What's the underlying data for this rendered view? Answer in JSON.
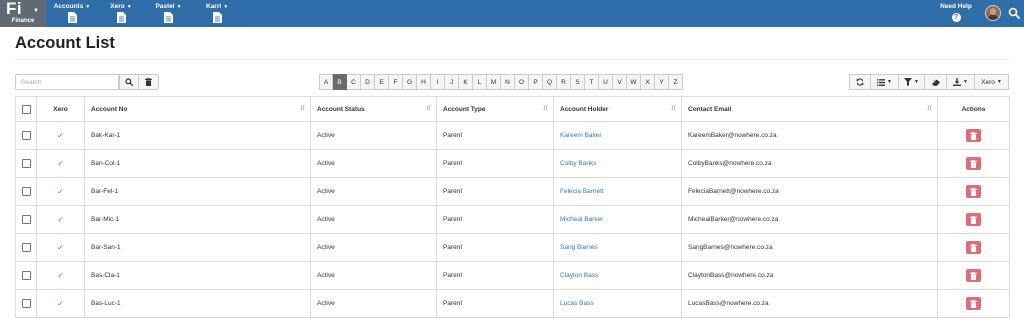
{
  "nav": {
    "brand_big": "Fi",
    "brand_small": "Finance",
    "items": [
      {
        "label": "Accounts"
      },
      {
        "label": "Xero"
      },
      {
        "label": "Pastel"
      },
      {
        "label": "Karri"
      }
    ],
    "help_label": "Need Help",
    "help_icon": "?"
  },
  "page": {
    "title": "Account List"
  },
  "search": {
    "placeholder": "Search",
    "value": ""
  },
  "alphabet": {
    "letters": [
      "A",
      "B",
      "C",
      "D",
      "E",
      "F",
      "G",
      "H",
      "I",
      "J",
      "K",
      "L",
      "M",
      "N",
      "O",
      "P",
      "Q",
      "R",
      "S",
      "T",
      "U",
      "V",
      "W",
      "X",
      "Y",
      "Z"
    ],
    "active": "B"
  },
  "toolbar": {
    "xero_label": "Xero"
  },
  "table": {
    "headers": {
      "xero": "Xero",
      "account_no": "Account No",
      "account_status": "Account Status",
      "account_type": "Account Type",
      "account_holder": "Account Holder",
      "contact_email": "Contact Email",
      "actions": "Actions"
    },
    "rows": [
      {
        "account_no": "Bak-Kar-1",
        "status": "Active",
        "type": "Parent",
        "holder": "Kareem Baker",
        "email": "KareemBaker@nowhere.co.za"
      },
      {
        "account_no": "Ban-Col-1",
        "status": "Active",
        "type": "Parent",
        "holder": "Colby Banks",
        "email": "ColbyBanks@nowhere.co.za"
      },
      {
        "account_no": "Bar-Fel-1",
        "status": "Active",
        "type": "Parent",
        "holder": "Felecia Barnett",
        "email": "FeleciaBarnett@nowhere.co.za"
      },
      {
        "account_no": "Bar-Mic-1",
        "status": "Active",
        "type": "Parent",
        "holder": "Micheal Barker",
        "email": "MichealBarker@nowhere.co.za"
      },
      {
        "account_no": "Bar-San-1",
        "status": "Active",
        "type": "Parent",
        "holder": "Sang Barnes",
        "email": "SangBarnes@nowhere.co.za"
      },
      {
        "account_no": "Bas-Cla-1",
        "status": "Active",
        "type": "Parent",
        "holder": "Clayton Bass",
        "email": "ClaytonBass@nowhere.co.za"
      },
      {
        "account_no": "Bas-Luc-1",
        "status": "Active",
        "type": "Parent",
        "holder": "Lucas Bass",
        "email": "LucasBass@nowhere.co.za"
      }
    ]
  },
  "colors": {
    "nav_bg": "#2f6ea8",
    "brand_bg": "#606a72",
    "delete_button": "#e06c75",
    "link": "#337ab7",
    "active_letter_bg": "#6b6b6b"
  }
}
